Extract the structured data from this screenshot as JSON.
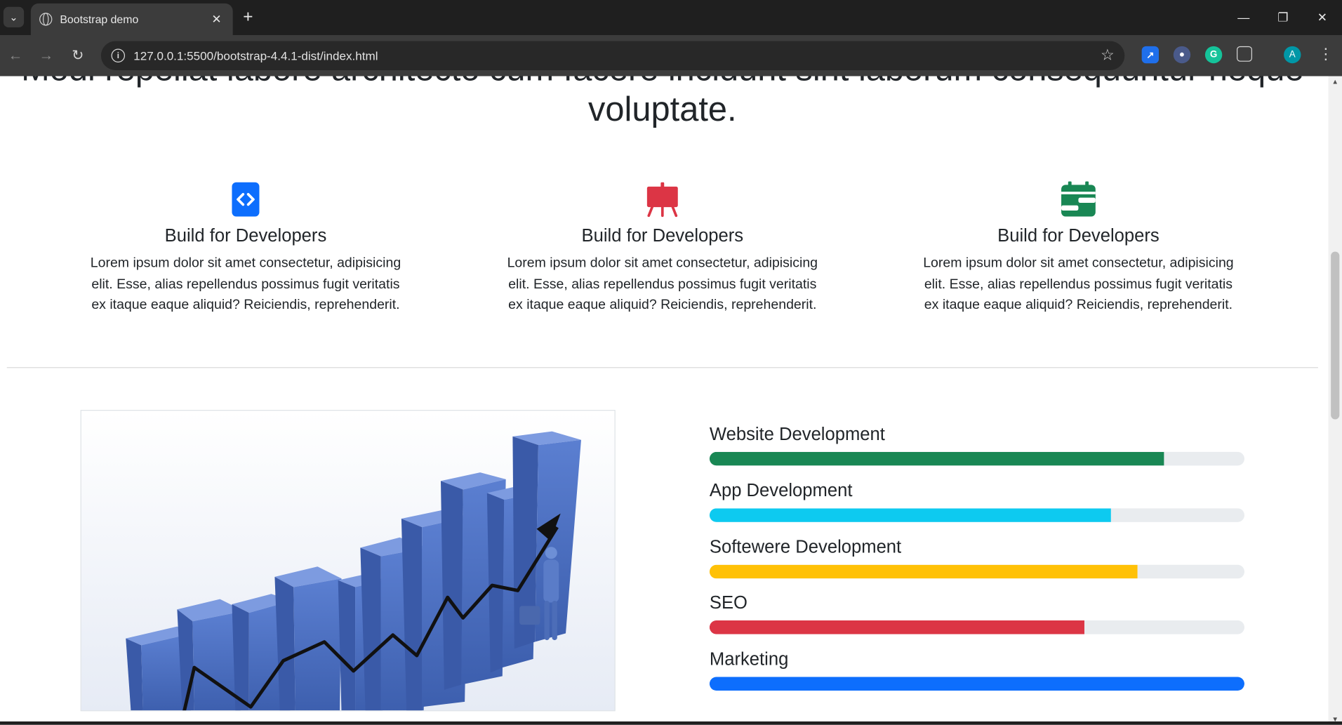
{
  "browser": {
    "tab_title": "Bootstrap demo",
    "url": "127.0.0.1:5500/bootstrap-4.4.1-dist/index.html",
    "avatar_letter": "A"
  },
  "page": {
    "lead_line_1": "Modi repellat labore architecto cum facere incidunt sint laborum consequuntur neque",
    "lead_line_2": "voluptate.",
    "features": [
      {
        "icon": "code-square-icon",
        "icon_color": "#0d6efd",
        "title": "Build for Developers",
        "text": "Lorem ipsum dolor sit amet consectetur, adipisicing elit. Esse, alias repellendus possimus fugit veritatis ex itaque eaque aliquid? Reiciendis, reprehenderit."
      },
      {
        "icon": "easel-icon",
        "icon_color": "#dc3545",
        "title": "Build for Developers",
        "text": "Lorem ipsum dolor sit amet consectetur, adipisicing elit. Esse, alias repellendus possimus fugit veritatis ex itaque eaque aliquid? Reiciendis, reprehenderit."
      },
      {
        "icon": "calendar-range-icon",
        "icon_color": "#198754",
        "title": "Build for Developers",
        "text": "Lorem ipsum dolor sit amet consectetur, adipisicing elit. Esse, alias repellendus possimus fugit veritatis ex itaque eaque aliquid? Reiciendis, reprehenderit."
      }
    ],
    "skills": [
      {
        "label": "Website Development",
        "percent": 85,
        "color": "#198754"
      },
      {
        "label": "App Development",
        "percent": 75,
        "color": "#0dcaf0"
      },
      {
        "label": "Softewere Development",
        "percent": 80,
        "color": "#ffc107"
      },
      {
        "label": "SEO",
        "percent": 70,
        "color": "#dc3545"
      },
      {
        "label": "Marketing",
        "percent": 100,
        "color": "#0d6efd"
      }
    ]
  }
}
